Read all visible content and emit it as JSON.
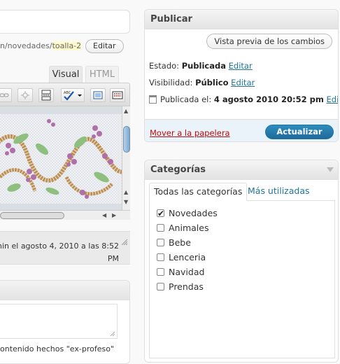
{
  "editor": {
    "permalink_prefix": "n/novedades/",
    "permalink_slug": "toalla-2",
    "edit_slug_label": "Editar",
    "tabs": {
      "visual": "Visual",
      "html": "HTML"
    },
    "last_edit_line1": "nin el agosto 4, 2010 a las 8:52",
    "last_edit_line2": "PM",
    "excerpt_help": "ontenido hechos \"ex-profeso\""
  },
  "publish": {
    "title": "Publicar",
    "preview_button": "Vista previa de los cambios",
    "status_label": "Estado:",
    "status_value": "Publicada",
    "status_edit": "Editar",
    "visibility_label": "Visibilidad:",
    "visibility_value": "Público",
    "visibility_edit": "Editar",
    "published_label": "Publicada el:",
    "published_value": "4 agosto 2010 20:52 pm",
    "published_edit": "Editar",
    "trash_link": "Mover a la papelera",
    "update_button": "Actualizar"
  },
  "categories": {
    "title": "Categorías",
    "tab_all": "Todas las categorías",
    "tab_popular": "Más utilizadas",
    "items": [
      {
        "label": "Novedades",
        "checked": true
      },
      {
        "label": "Animales",
        "checked": false
      },
      {
        "label": "Bebe",
        "checked": false
      },
      {
        "label": "Lenceria",
        "checked": false
      },
      {
        "label": "Navidad",
        "checked": false
      },
      {
        "label": "Prendas",
        "checked": false
      }
    ]
  },
  "colors": {
    "link": "#21759b",
    "trash": "#bc0b0b",
    "update_button": "#21759b",
    "major_actions_bg": "#eaf2fa",
    "slug_highlight": "#fffbcc"
  }
}
